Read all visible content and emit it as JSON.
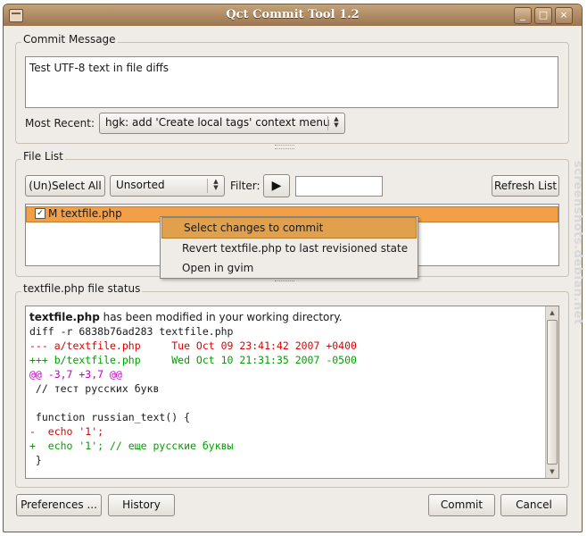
{
  "window": {
    "title": "Qct Commit Tool 1.2",
    "controls": {
      "minimize": "_",
      "maximize": "□",
      "close": "×"
    }
  },
  "commit_message": {
    "frame_label": "Commit Message",
    "text": "Test UTF-8 text in file diffs",
    "most_recent_label": "Most Recent:",
    "most_recent_value": "hgk: add 'Create local tags' context menu"
  },
  "file_list": {
    "frame_label": "File List",
    "select_all_label": "(Un)Select All",
    "sort_value": "Unsorted",
    "filter_label": "Filter:",
    "filter_value": "",
    "refresh_label": "Refresh List",
    "files": [
      {
        "checked": true,
        "label": "M textfile.php"
      }
    ]
  },
  "context_menu": {
    "items": [
      {
        "label": "Select changes to commit",
        "active": true
      },
      {
        "label": "Revert textfile.php to last revisioned state",
        "active": false
      },
      {
        "label": "Open in gvim",
        "active": false
      }
    ]
  },
  "file_status": {
    "frame_label": "textfile.php file status",
    "header_bold": "textfile.php",
    "header_rest": " has been modified in your working directory.",
    "lines": [
      {
        "text": "diff -r 6838b76ad283 textfile.php",
        "color": "#1a1a1a"
      },
      {
        "text": "--- a/textfile.php     Tue Oct 09 23:41:42 2007 +0400",
        "color": "#e00000"
      },
      {
        "text": "+++ b/textfile.php     Wed Oct 10 21:31:35 2007 -0500",
        "color": "#00a000"
      },
      {
        "text": "@@ -3,7 +3,7 @@",
        "color": "#c000c0"
      },
      {
        "text": " // тест русских букв",
        "color": "#1a1a1a"
      },
      {
        "text": "",
        "color": "#1a1a1a"
      },
      {
        "text": " function russian_text() {",
        "color": "#1a1a1a"
      },
      {
        "text": "-  echo '1';",
        "color": "#e00000"
      },
      {
        "text": "+  echo '1'; // еще русские буквы",
        "color": "#00a000"
      },
      {
        "text": " }",
        "color": "#1a1a1a"
      }
    ]
  },
  "buttons": {
    "preferences": "Preferences ...",
    "history": "History",
    "commit": "Commit",
    "cancel": "Cancel"
  },
  "watermark": "screenshots.debian.net"
}
